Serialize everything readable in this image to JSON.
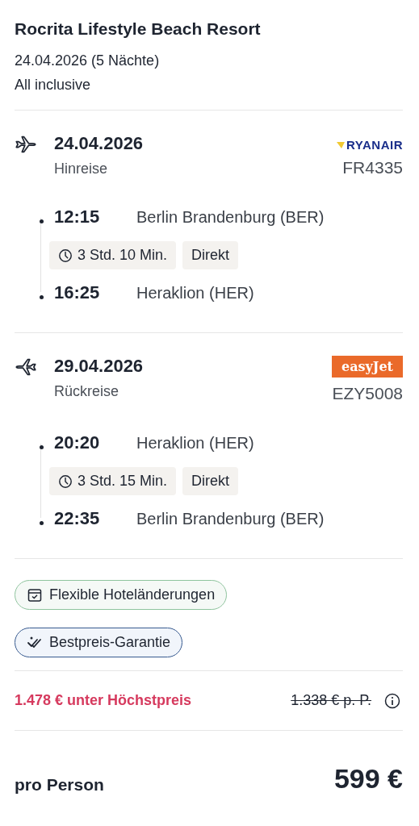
{
  "hotel": {
    "name": "Rocrita Lifestyle Beach Resort",
    "dates": "24.04.2026 (5 Nächte)",
    "board": "All inclusive"
  },
  "flights": [
    {
      "kind": "outbound",
      "date": "24.04.2026",
      "direction": "Hinreise",
      "airline": {
        "kind": "ryanair",
        "name": "RYANAIR"
      },
      "flight_no": "FR4335",
      "stops": [
        {
          "time": "12:15",
          "place": "Berlin Brandenburg (BER)"
        },
        {
          "time": "16:25",
          "place": "Heraklion (HER)"
        }
      ],
      "duration": "3 Std. 10 Min.",
      "connection": "Direkt"
    },
    {
      "kind": "return",
      "date": "29.04.2026",
      "direction": "Rückreise",
      "airline": {
        "kind": "easyjet",
        "name": "easyJet"
      },
      "flight_no": "EZY5008",
      "stops": [
        {
          "time": "20:20",
          "place": "Heraklion (HER)"
        },
        {
          "time": "22:35",
          "place": "Berlin Brandenburg (BER)"
        }
      ],
      "duration": "3 Std. 15 Min.",
      "connection": "Direkt"
    }
  ],
  "badges": [
    {
      "kind": "flexible",
      "label": "Flexible Hoteländerungen"
    },
    {
      "kind": "bestprice",
      "label": "Bestpreis-Garantie"
    }
  ],
  "savings": {
    "text": "1.478 € unter Höchstpreis",
    "old_price": "1.338 € p. P."
  },
  "total": {
    "label": "pro Person",
    "price": "599 €"
  }
}
